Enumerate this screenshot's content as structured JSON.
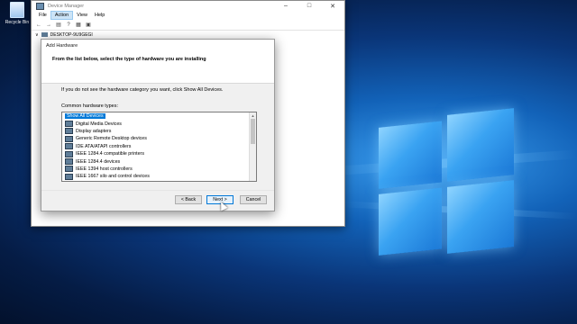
{
  "desktop": {
    "icons": [
      {
        "label": "Recycle Bin",
        "icon": "recycle-bin-icon"
      }
    ]
  },
  "window": {
    "title": "Device Manager",
    "menu": [
      "File",
      "Action",
      "View",
      "Help"
    ],
    "active_menu": "Action",
    "toolbar_icons": [
      "back-arrow-icon",
      "forward-arrow-icon",
      "properties-icon",
      "help-icon",
      "update-driver-icon",
      "scan-hardware-icon"
    ],
    "tree_root": "DESKTOP-9U9GEGI"
  },
  "dialog": {
    "title": "Add Hardware",
    "heading": "From the list below, select the type of hardware you are installing",
    "hint": "If you do not see the hardware category you want, click Show All Devices.",
    "list_label": "Common hardware types:",
    "items": [
      {
        "label": "Show All Devices",
        "selected": true
      },
      {
        "label": "Digital Media Devices"
      },
      {
        "label": "Display adapters"
      },
      {
        "label": "Generic Remote Desktop devices"
      },
      {
        "label": "IDE ATA/ATAPI controllers"
      },
      {
        "label": "IEEE 1284.4 compatible printers"
      },
      {
        "label": "IEEE 1284.4 devices"
      },
      {
        "label": "IEEE 1394 host controllers"
      },
      {
        "label": "IEEE 1667 silo and control devices"
      }
    ],
    "buttons": {
      "back": "< Back",
      "next": "Next >",
      "cancel": "Cancel"
    }
  },
  "colors": {
    "selection": "#0078d7",
    "wallpaper": "#0a3578"
  }
}
